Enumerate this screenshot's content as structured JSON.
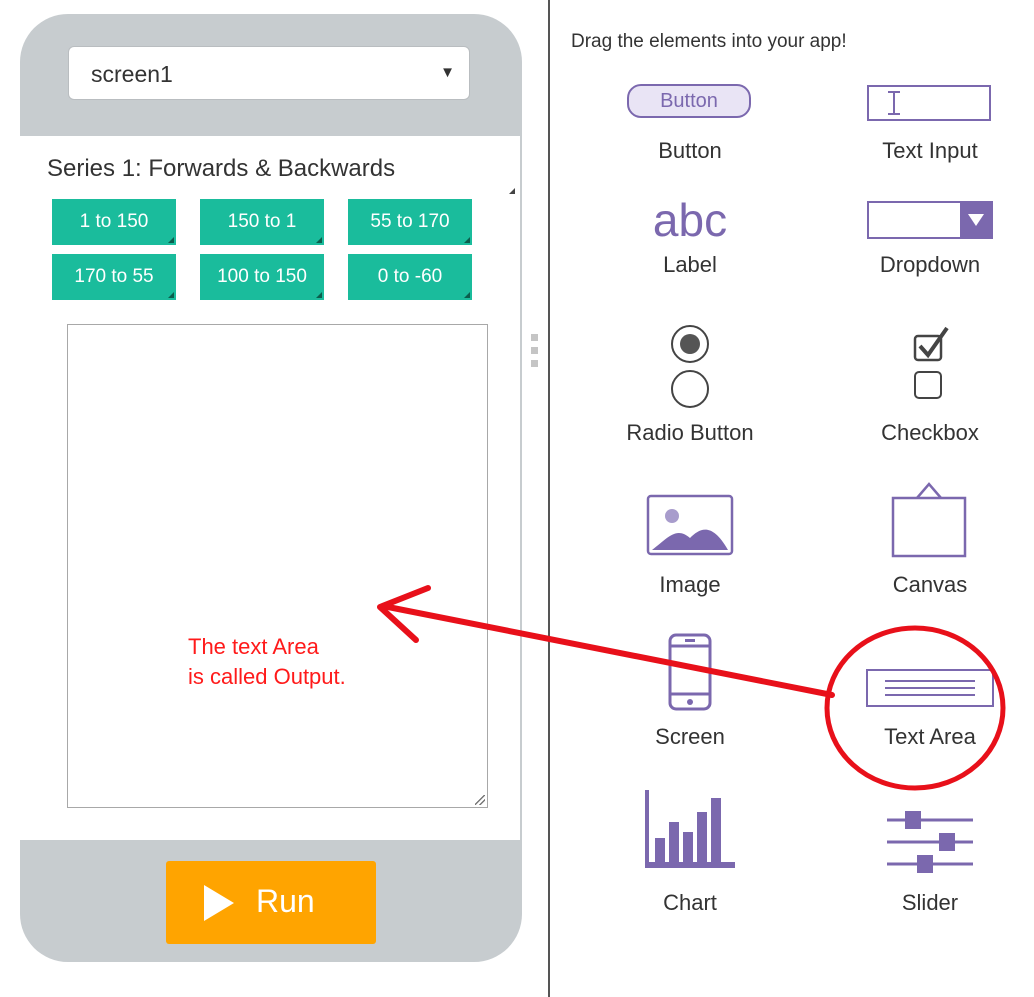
{
  "app": {
    "screen_select": {
      "value": "screen1"
    },
    "series_label": "Series 1: Forwards & Backwards",
    "buttons": [
      "1 to 150",
      "150 to 1",
      "55 to 170",
      "170 to 55",
      "100 to 150",
      "0 to -60"
    ],
    "run_label": "Run",
    "colors": {
      "button": "#1abc9c",
      "run": "#ffa400",
      "phone": "#c7cccf"
    }
  },
  "toolbox": {
    "title": "Drag the elements into your app!",
    "button_preview": "Button",
    "label_preview": "abc",
    "items": [
      {
        "label": "Button",
        "icon": "button-preview-icon"
      },
      {
        "label": "Text Input",
        "icon": "text-input-icon"
      },
      {
        "label": "Label",
        "icon": "label-abc-icon"
      },
      {
        "label": "Dropdown",
        "icon": "dropdown-icon"
      },
      {
        "label": "Radio Button",
        "icon": "radio-button-icon"
      },
      {
        "label": "Checkbox",
        "icon": "checkbox-icon"
      },
      {
        "label": "Image",
        "icon": "image-icon"
      },
      {
        "label": "Canvas",
        "icon": "canvas-icon"
      },
      {
        "label": "Screen",
        "icon": "phone-screen-icon"
      },
      {
        "label": "Text Area",
        "icon": "text-area-icon"
      },
      {
        "label": "Chart",
        "icon": "bar-chart-icon"
      },
      {
        "label": "Slider",
        "icon": "slider-icon"
      }
    ],
    "accent": "#7b68ae"
  },
  "annotation": {
    "lines": [
      "The text Area",
      "is called Output."
    ],
    "color": "#ff1a1a"
  }
}
